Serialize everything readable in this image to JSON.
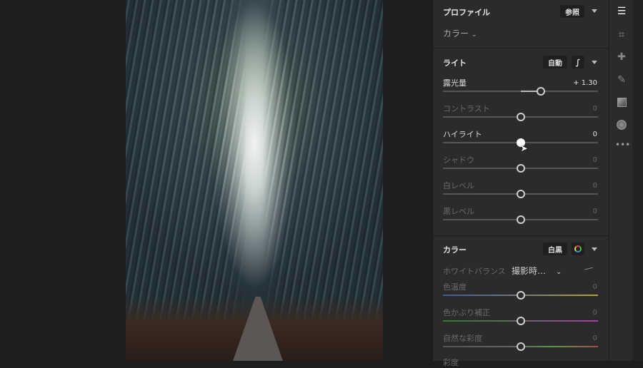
{
  "profile": {
    "title": "プロファイル",
    "browse_label": "参照",
    "value": "カラー"
  },
  "light": {
    "title": "ライト",
    "auto_label": "自動",
    "sliders": [
      {
        "label": "露光量",
        "value": "+ 1.30",
        "num": 1.3,
        "min": -5,
        "max": 5,
        "active": true
      },
      {
        "label": "コントラスト",
        "value": "0",
        "num": 0,
        "min": -100,
        "max": 100,
        "active": false
      },
      {
        "label": "ハイライト",
        "value": "0",
        "num": 0,
        "min": -100,
        "max": 100,
        "active": true
      },
      {
        "label": "シャドウ",
        "value": "0",
        "num": 0,
        "min": -100,
        "max": 100,
        "active": false
      },
      {
        "label": "白レベル",
        "value": "0",
        "num": 0,
        "min": -100,
        "max": 100,
        "active": false
      },
      {
        "label": "黒レベル",
        "value": "0",
        "num": 0,
        "min": -100,
        "max": 100,
        "active": false
      }
    ]
  },
  "color": {
    "title": "カラー",
    "bw_label": "白黒",
    "wb_label": "ホワイトバランス",
    "wb_value": "撮影時…",
    "sliders": [
      {
        "label": "色温度",
        "value": "0",
        "num": 0,
        "min": -100,
        "max": 100,
        "gradient": "linear-gradient(90deg,#3a5a9a,#777 50%,#a8a83a)"
      },
      {
        "label": "色かぶり補正",
        "value": "0",
        "num": 0,
        "min": -100,
        "max": 100,
        "gradient": "linear-gradient(90deg,#2f7a2f,#666 50%,#b03ab0)"
      },
      {
        "label": "自然な彩度",
        "value": "0",
        "num": 0,
        "min": -100,
        "max": 100,
        "gradient": "linear-gradient(90deg,#555,#666 50%,#5a9a4a 70%,#a05050)"
      }
    ],
    "next_label": "彩度"
  }
}
